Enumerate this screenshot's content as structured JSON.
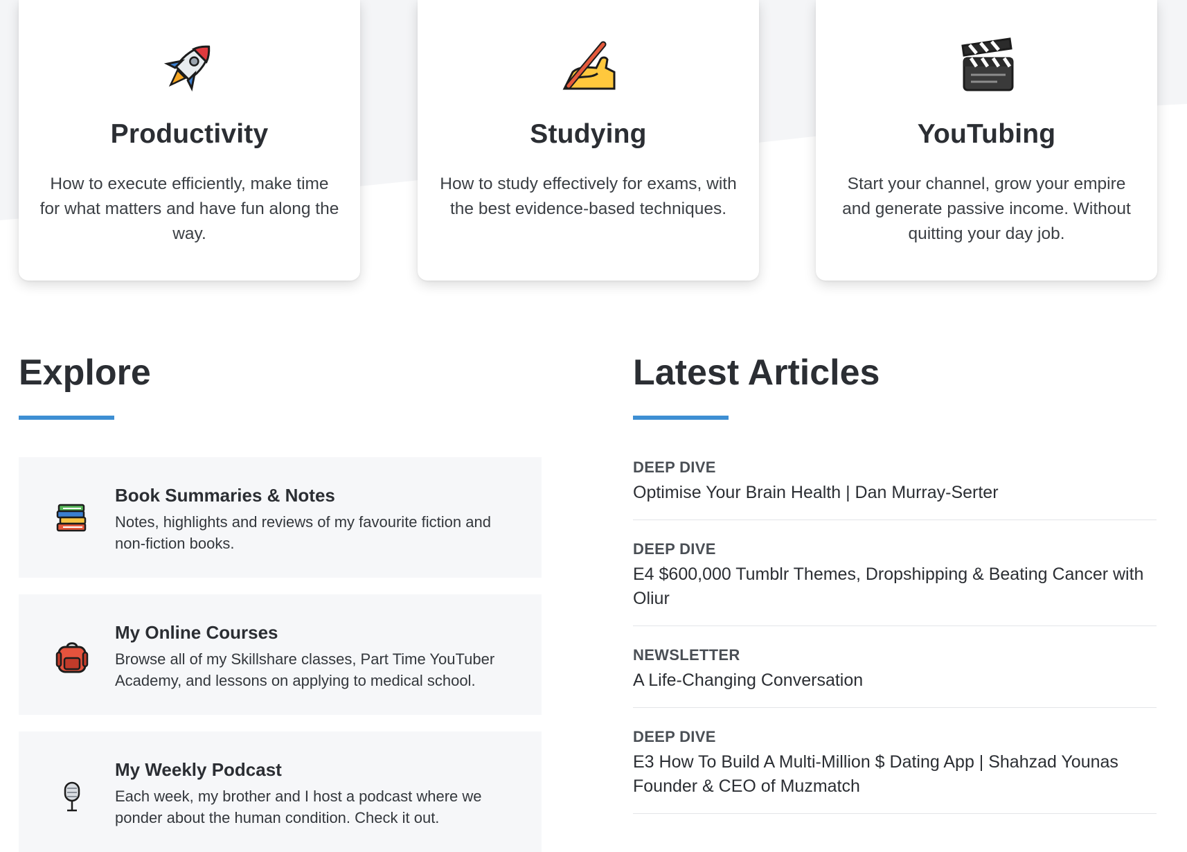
{
  "topics": [
    {
      "title": "Productivity",
      "description": "How to execute efficiently, make time for what matters and have fun along the way.",
      "icon": "rocket-icon"
    },
    {
      "title": "Studying",
      "description": "How to study effectively for exams, with the best evidence-based techniques.",
      "icon": "writing-hand-icon"
    },
    {
      "title": "YouTubing",
      "description": "Start your channel, grow your empire and generate passive income. Without quitting your day job.",
      "icon": "clapper-board-icon"
    }
  ],
  "explore": {
    "heading": "Explore",
    "items": [
      {
        "title": "Book Summaries & Notes",
        "description": "Notes, highlights and reviews of my favourite fiction and non-fiction books.",
        "icon": "books-icon"
      },
      {
        "title": "My Online Courses",
        "description": "Browse all of my Skillshare classes, Part Time YouTuber Academy, and lessons on applying to medical school.",
        "icon": "backpack-icon"
      },
      {
        "title": "My Weekly Podcast",
        "description": "Each week, my brother and I host a podcast where we ponder about the human condition. Check it out.",
        "icon": "microphone-icon"
      }
    ]
  },
  "articles": {
    "heading": "Latest Articles",
    "items": [
      {
        "category": "DEEP DIVE",
        "title": "Optimise Your Brain Health | Dan Murray-Serter"
      },
      {
        "category": "DEEP DIVE",
        "title": "E4 $600,000 Tumblr Themes, Dropshipping & Beating Cancer with Oliur"
      },
      {
        "category": "NEWSLETTER",
        "title": "A Life-Changing Conversation"
      },
      {
        "category": "DEEP DIVE",
        "title": "E3 How To Build A Multi-Million $ Dating App | Shahzad Younas Founder & CEO of Muzmatch"
      }
    ]
  },
  "colors": {
    "accent": "#3e8fd3",
    "background_wave": "#f4f5f7",
    "card_background": "#ffffff",
    "explore_item_background": "#f6f7f9"
  }
}
